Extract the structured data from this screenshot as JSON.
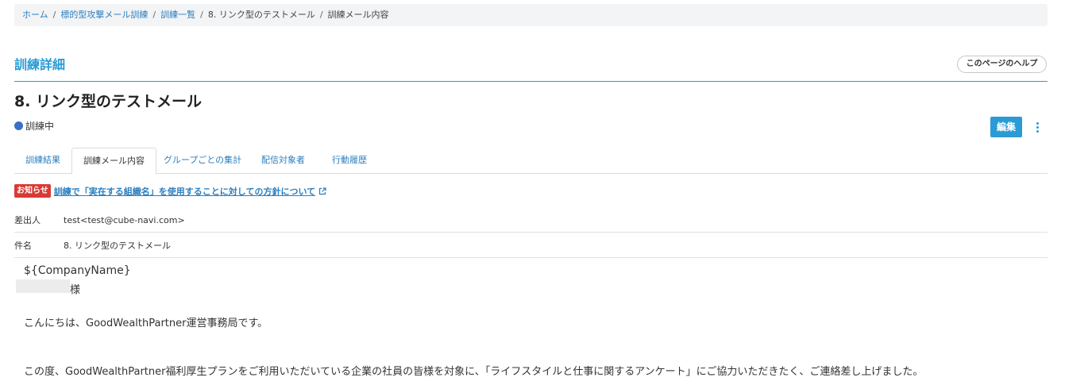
{
  "breadcrumb": {
    "items": [
      "ホーム",
      "標的型攻撃メール訓練",
      "訓練一覧",
      "8. リンク型のテストメール",
      "訓練メール内容"
    ],
    "separator": "/"
  },
  "header": {
    "section_title": "訓練詳細",
    "help_label": "このページのヘルプ"
  },
  "training": {
    "title": "8. リンク型のテストメール",
    "status": "訓練中",
    "status_color": "#3a6fc7"
  },
  "actions": {
    "edit_label": "編集",
    "more_icon": "vertical-ellipsis-icon"
  },
  "tabs": [
    {
      "label": "訓練結果",
      "active": false
    },
    {
      "label": "訓練メール内容",
      "active": true
    },
    {
      "label": "グループごとの集計",
      "active": false
    },
    {
      "label": "配信対象者",
      "active": false
    },
    {
      "label": "行動履歴",
      "active": false
    }
  ],
  "notice": {
    "badge": "お知らせ",
    "link_text": "訓練で「実在する組織名」を使用することに対しての方針について",
    "icon": "external-link-icon"
  },
  "mail": {
    "sender_label": "差出人",
    "sender_value": "test<test@cube-navi.com>",
    "subject_label": "件名",
    "subject_value": "8. リンク型のテストメール",
    "body": {
      "company_placeholder": "${CompanyName}",
      "honorific": "様",
      "greeting": "こんにちは、GoodWealthPartner運営事務局です。",
      "paragraph1": "この度、GoodWealthPartner福利厚生プランをご利用いただいている企業の社員の皆様を対象に、「ライフスタイルと仕事に関するアンケート」にご協力いただきたく、ご連絡差し上げました。"
    }
  },
  "colors": {
    "accent": "#2a9bd5",
    "link": "#2a7fc0",
    "notice_badge": "#d93a35"
  }
}
